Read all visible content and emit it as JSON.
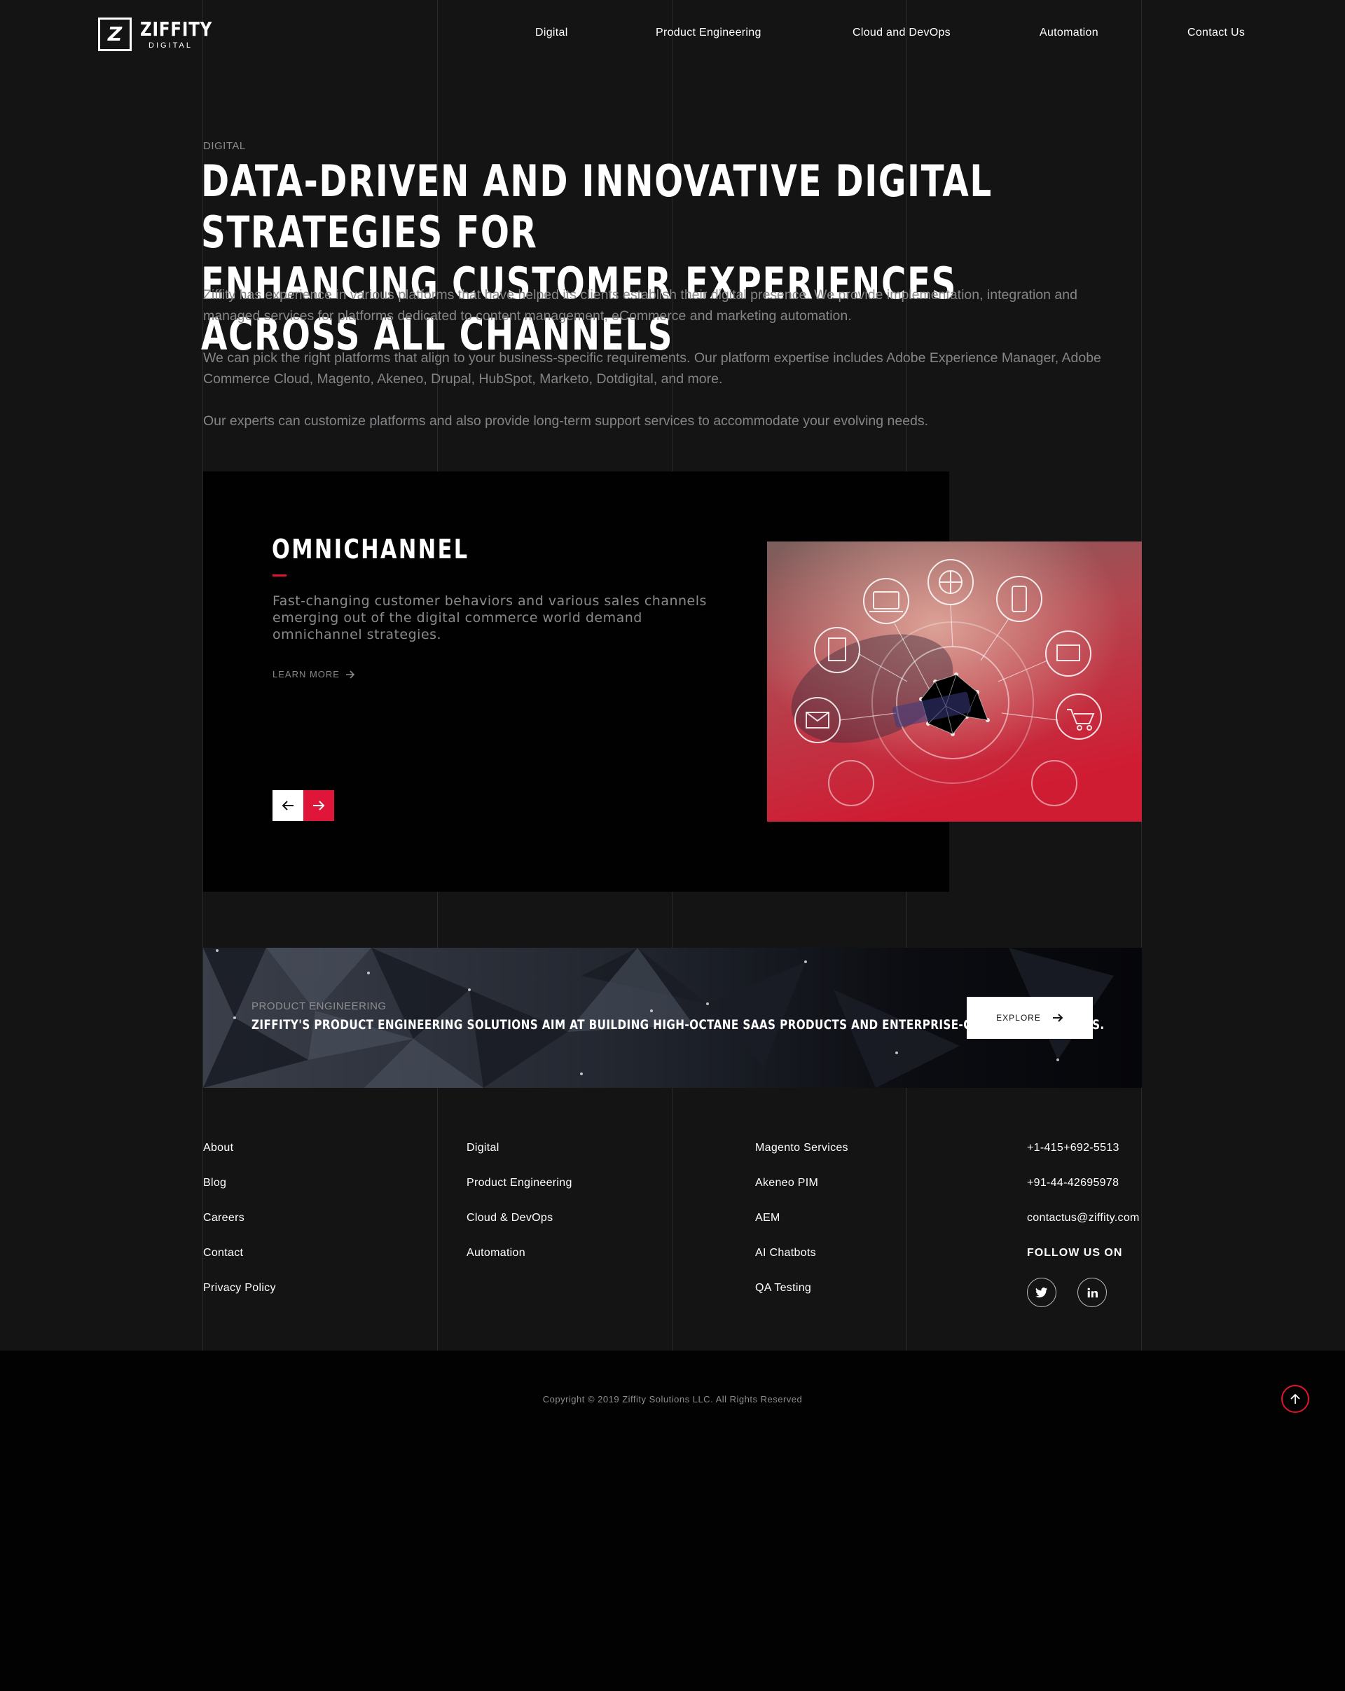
{
  "header": {
    "logo": {
      "name": "ZIFFITY",
      "sub": "DIGITAL",
      "mark": "Z"
    },
    "nav": [
      "Digital",
      "Product Engineering",
      "Cloud and DevOps",
      "Automation",
      "Contact Us"
    ]
  },
  "hero": {
    "kicker": "DIGITAL",
    "headline_line1": "DATA-DRIVEN AND INNOVATIVE DIGITAL STRATEGIES FOR",
    "headline_line2": "ENHANCING CUSTOMER EXPERIENCES ACROSS ALL CHANNELS",
    "paragraphs": [
      "Ziffity has experience in various platforms that have helped its clients establish their digital presence. We provide implementation, integration and managed services for platforms dedicated to content management, eCommerce and marketing automation.",
      "We can pick the right platforms that align to your business-specific requirements. Our platform expertise includes Adobe Experience Manager, Adobe Commerce Cloud, Magento, Akeneo, Drupal, HubSpot, Marketo, Dotdigital, and more.",
      "Our experts can customize platforms and also provide long-term support services to accommodate your evolving needs."
    ]
  },
  "slider": {
    "title": "OMNICHANNEL",
    "description": "Fast-changing customer behaviors and various sales channels emerging out of the digital commerce world demand omnichannel strategies.",
    "learn_more": "LEARN MORE",
    "prev_icon": "arrow-left-icon",
    "next_icon": "arrow-right-icon",
    "accent": "#e0153a"
  },
  "banner": {
    "kicker": "PRODUCT ENGINEERING",
    "title": "ZIFFITY'S PRODUCT ENGINEERING SOLUTIONS AIM AT BUILDING HIGH-OCTANE SAAS PRODUCTS AND ENTERPRISE-GRADE APPLICATIONS.",
    "button": "EXPLORE"
  },
  "footer": {
    "col1": [
      "About",
      "Blog",
      "Careers",
      "Contact",
      "Privacy Policy"
    ],
    "col2": [
      "Digital",
      "Product Engineering",
      "Cloud & DevOps",
      "Automation"
    ],
    "col3": [
      "Magento Services",
      "Akeneo PIM",
      "AEM",
      "AI Chatbots",
      "QA Testing"
    ],
    "contact": [
      "+1-415+692-5513",
      "+91-44-42695978",
      "contactus@ziffity.com"
    ],
    "follow": "FOLLOW US ON",
    "social": [
      "twitter-icon",
      "linkedin-icon"
    ],
    "copyright": "Copyright © 2019 Ziffity Solutions LLC. All Rights Reserved"
  }
}
